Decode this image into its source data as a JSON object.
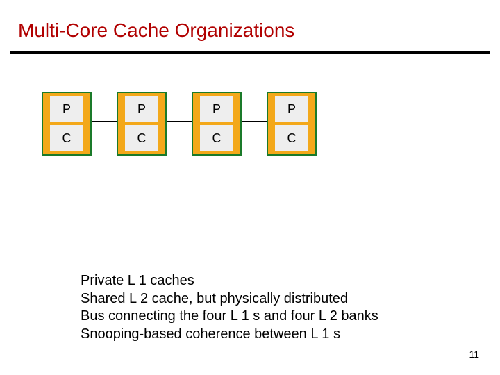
{
  "title": "Multi-Core Cache Organizations",
  "cores": {
    "p_label": "P",
    "c_label": "C"
  },
  "description": {
    "line1": "Private L 1 caches",
    "line2": "Shared L 2 cache, but physically distributed",
    "line3": "Bus connecting the four L 1 s and four L 2 banks",
    "line4": "Snooping-based coherence between L 1 s"
  },
  "page_number": "11"
}
